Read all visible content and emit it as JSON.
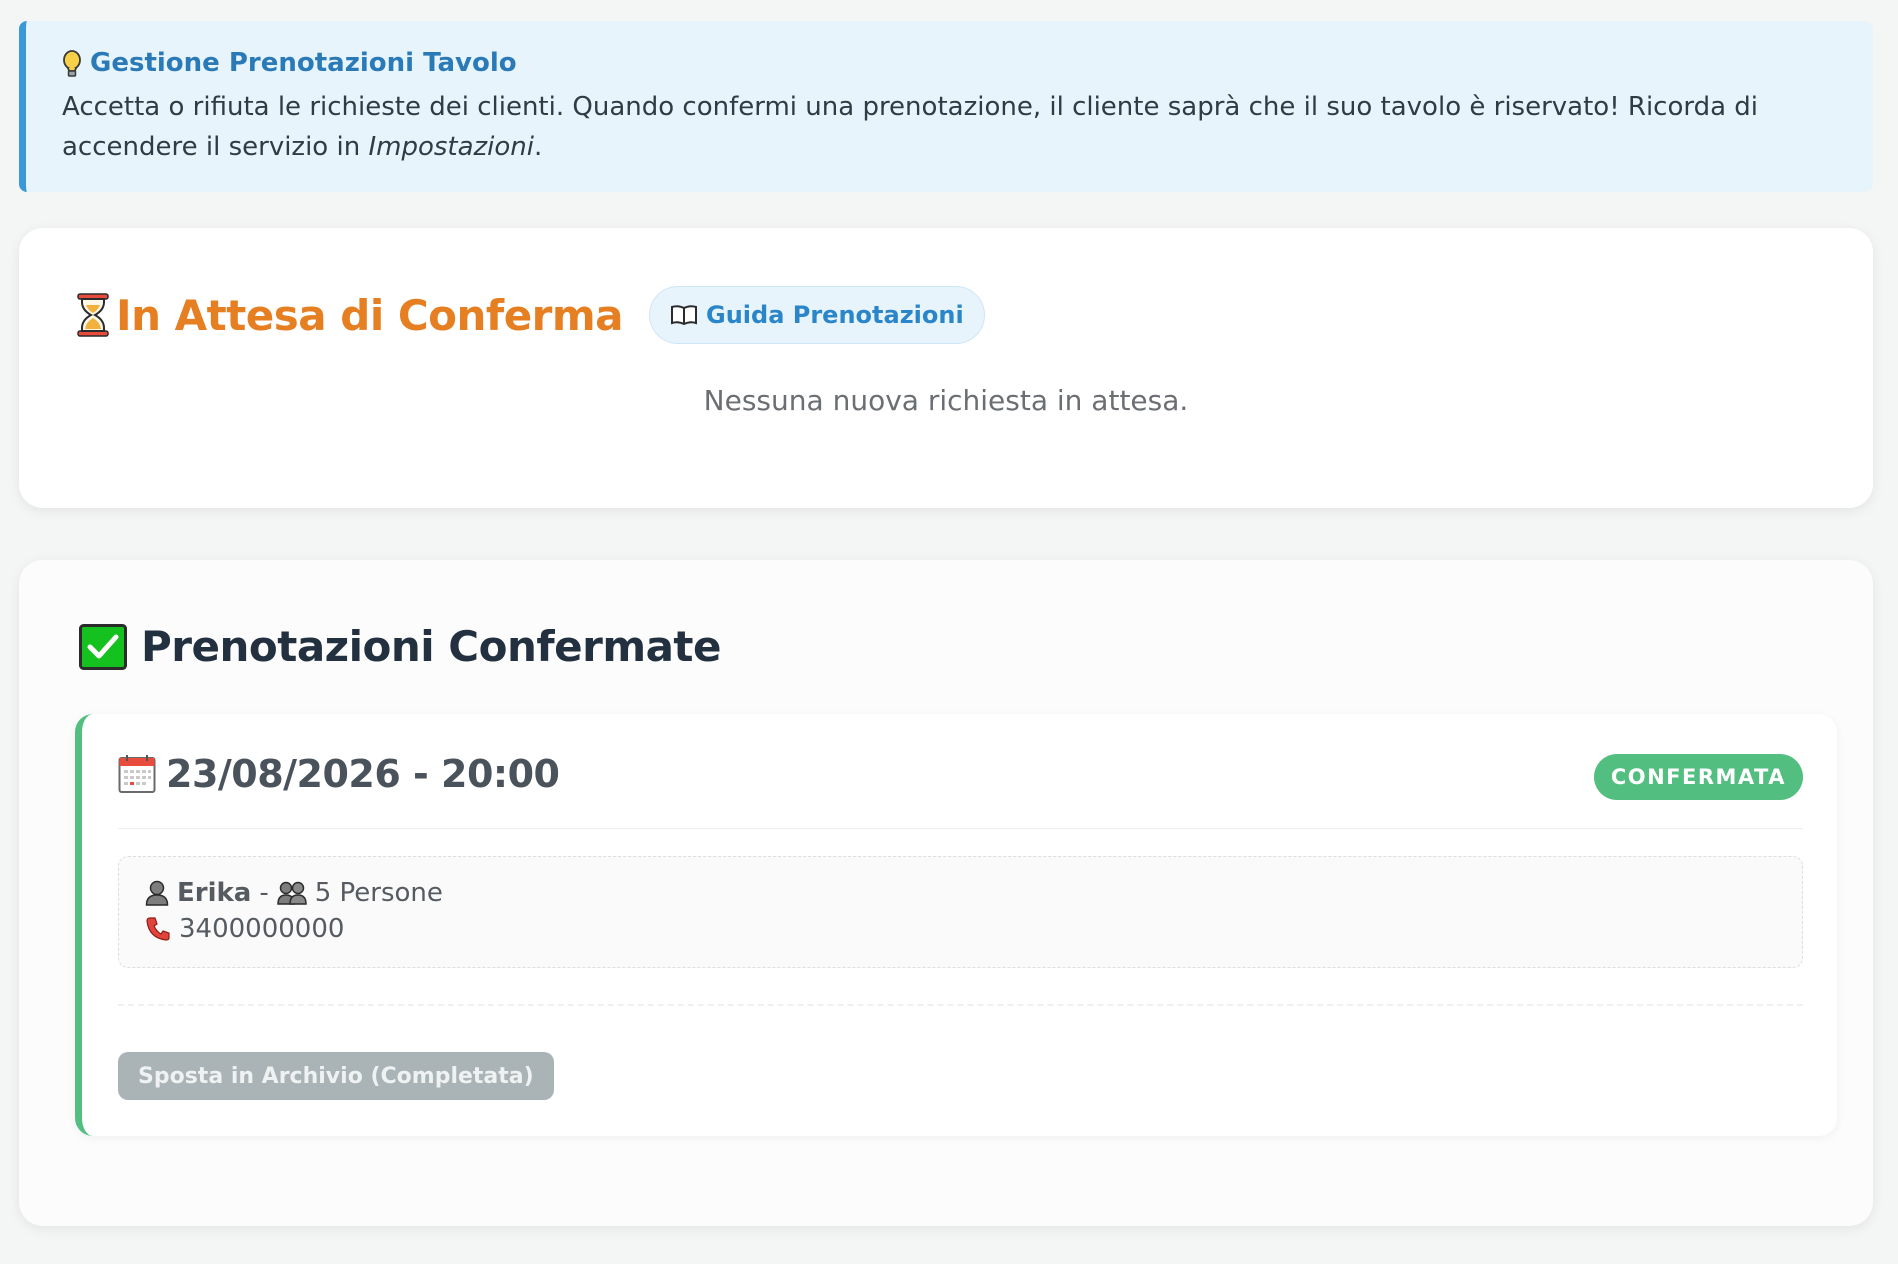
{
  "info": {
    "title": "Gestione Prenotazioni Tavolo",
    "text_before": "Accetta o rifiuta le richieste dei clienti. Quando confermi una prenotazione, il cliente saprà che il suo tavolo è riservato! Ricorda di accendere il servizio in ",
    "text_link": "Impostazioni",
    "text_after": ".",
    "icon": "lightbulb-icon",
    "accent_color": "#3a98d6"
  },
  "pending": {
    "icon": "hourglass-icon",
    "title": "In Attesa di Conferma",
    "guide_button": "Guida Prenotazioni",
    "guide_icon": "book-icon",
    "empty_message": "Nessuna nuova richiesta in attesa.",
    "title_color": "#e67e22"
  },
  "confirmed": {
    "icon": "check-box-icon",
    "title": "Prenotazioni Confermate",
    "bookings": [
      {
        "date_icon": "calendar-icon",
        "datetime": "23/08/2026 - 20:00",
        "status": "CONFERMATA",
        "status_color": "#52be80",
        "client_icon": "person-icon",
        "client_name": "Erika",
        "separator": "-",
        "people_icon": "people-icon",
        "people": "5 Persone",
        "phone_icon": "phone-icon",
        "phone": "3400000000",
        "archive_button": "Sposta in Archivio (Completata)"
      }
    ]
  }
}
